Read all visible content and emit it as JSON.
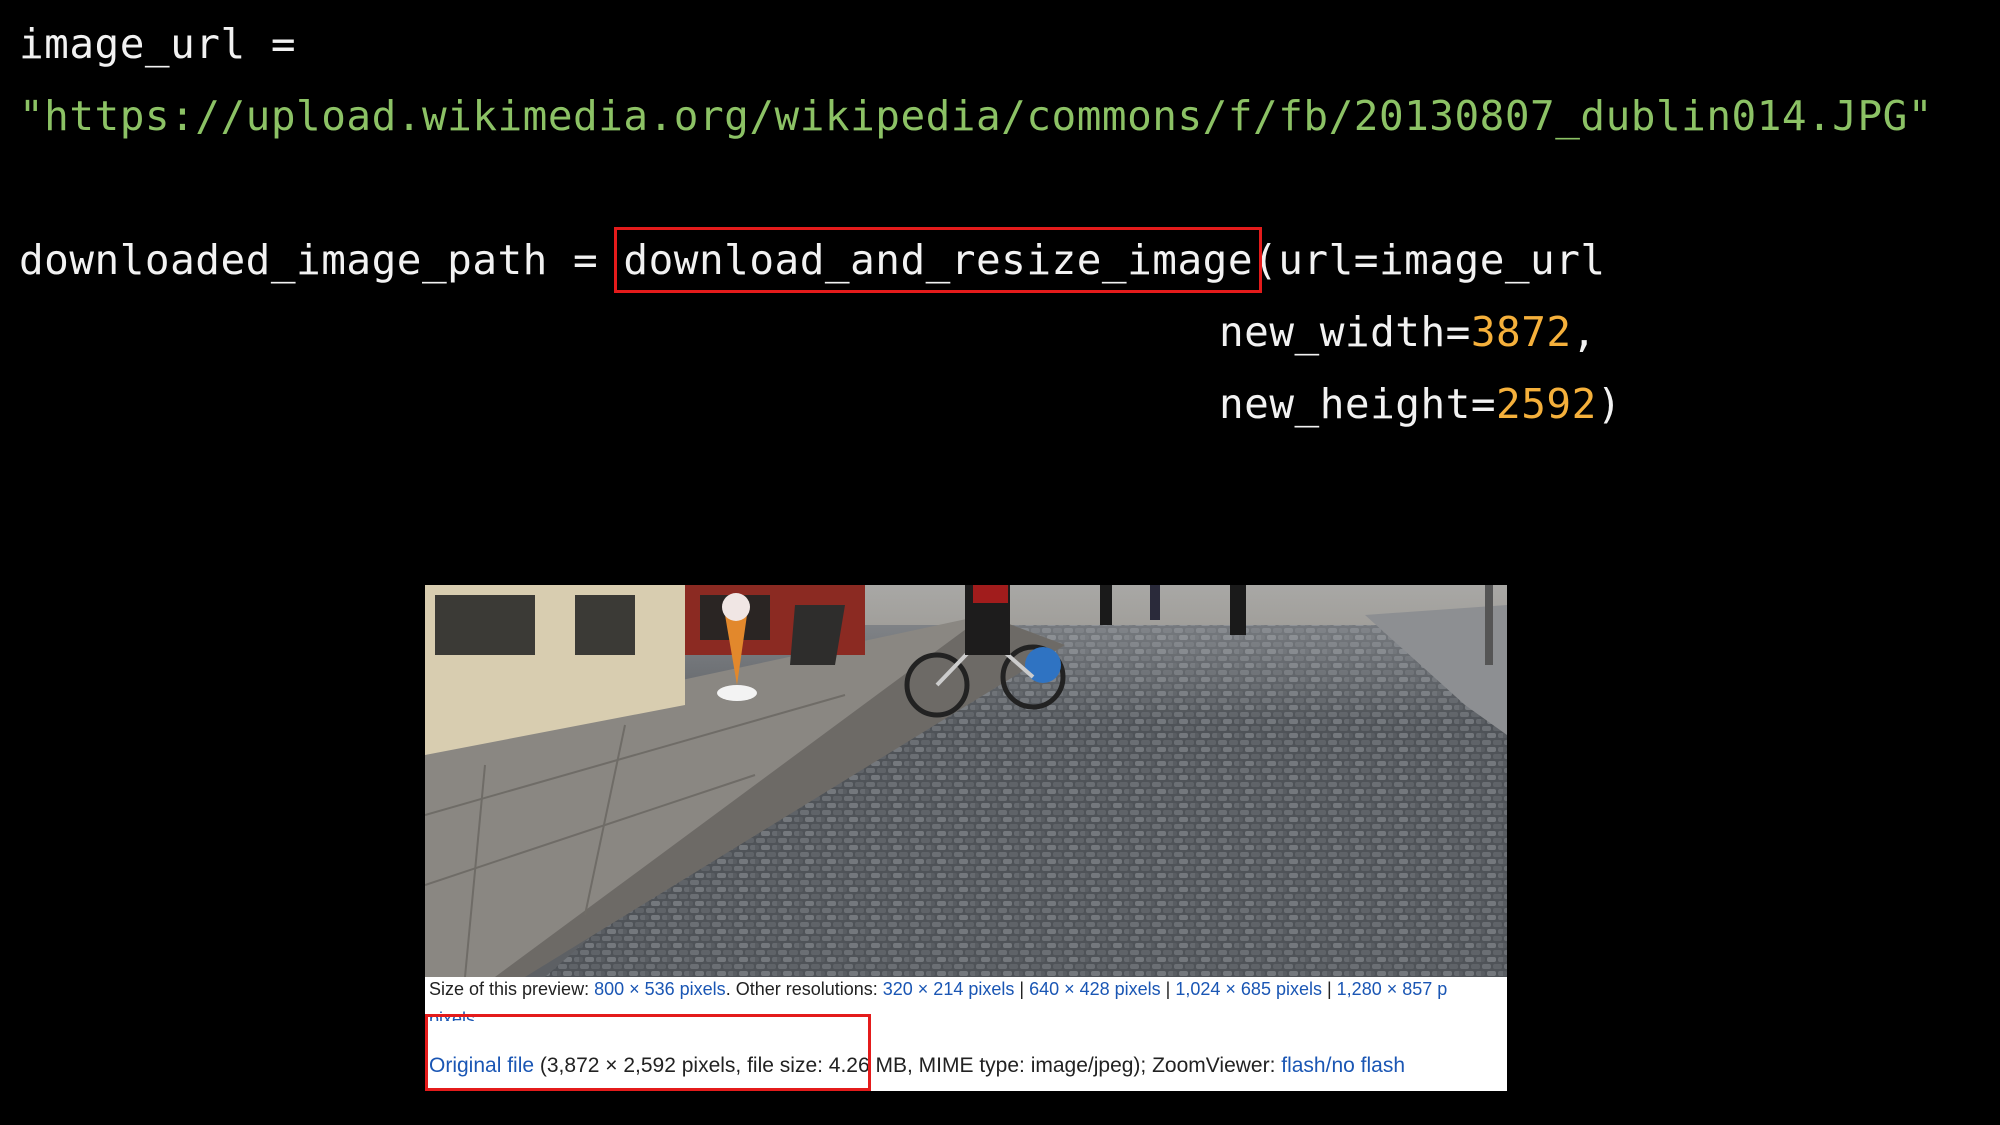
{
  "code": {
    "line1": "image_url =",
    "line2_url": "\"https://upload.wikimedia.org/wikipedia/commons/f/fb/20130807_dublin014.JPG\"",
    "line4_var": "downloaded_image_path = ",
    "line4_func": "download_and_resize_image",
    "line4_args": "(url=image_url",
    "line5_key": "new_width=",
    "line5_val": "3872",
    "line5_tail": ",",
    "line6_key": "new_height=",
    "line6_val": "2592",
    "line6_tail": ")"
  },
  "wiki": {
    "preview_label": "Size of this preview: ",
    "preview_link": "800 × 536 pixels",
    "other_label": ". Other resolutions: ",
    "res1": "320 × 214 pixels",
    "sep": " | ",
    "res2": "640 × 428 pixels",
    "res3": "1,024 × 685 pixels",
    "res4": "1,280 × 857 p",
    "wrap_text": "pixels.",
    "original_link": "Original file",
    "original_details": " (3,872 × 2,592 pixels, file size: 4.26 MB, MIME type: image/jpeg); ZoomViewer: ",
    "zoom_link": "flash/no flash"
  },
  "colors": {
    "background": "#000000",
    "code_text": "#f2f2f2",
    "string": "#8cc265",
    "number": "#f5b03b",
    "highlight": "#e41b1b",
    "link": "#1a56b4"
  }
}
